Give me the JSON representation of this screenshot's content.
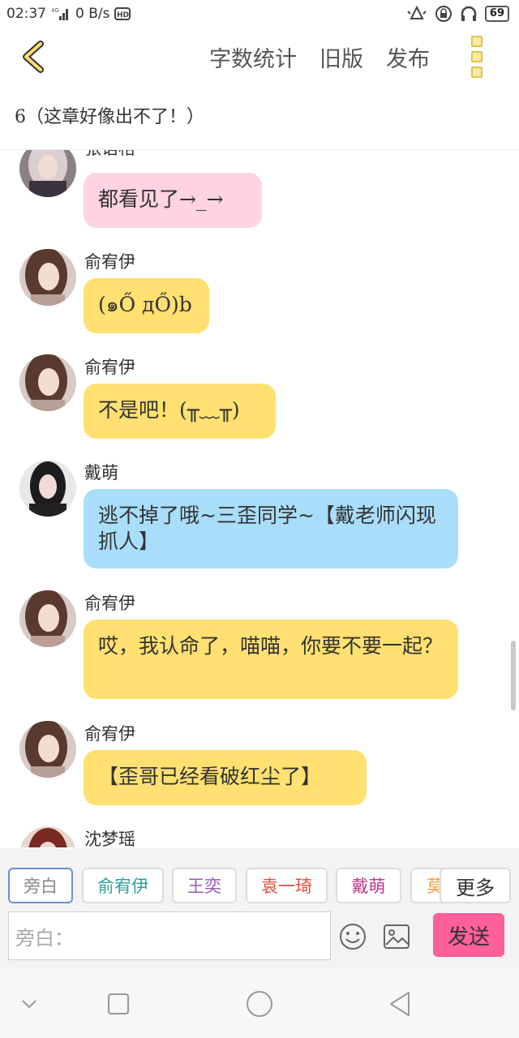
{
  "status_bar": {
    "time": "02:37",
    "network_speed": "0 B/s",
    "battery": "69"
  },
  "header": {
    "actions": [
      "字数统计",
      "旧版",
      "发布"
    ]
  },
  "chapter": {
    "title": "6（这章好像出不了！）"
  },
  "messages": [
    {
      "sender": "张语格",
      "text": "都看见了→_→",
      "bubble_color": "#ffd3df"
    },
    {
      "sender": "俞宥伊",
      "text": "(๑Ő дŐ)b",
      "bubble_color": "#ffe070"
    },
    {
      "sender": "俞宥伊",
      "text": "不是吧！(╥﹏╥)",
      "bubble_color": "#ffe070"
    },
    {
      "sender": "戴萌",
      "text": "逃不掉了哦~三歪同学~【戴老师闪现抓人】",
      "bubble_color": "#a9defb"
    },
    {
      "sender": "俞宥伊",
      "text": "哎，我认命了，喵喵，你要不要一起？",
      "bubble_color": "#ffe070"
    },
    {
      "sender": "俞宥伊",
      "text": "【歪哥已经看破红尘了】",
      "bubble_color": "#ffe070"
    },
    {
      "sender": "沈梦瑶",
      "text": "",
      "bubble_color": "#ffd3df"
    }
  ],
  "roles": [
    {
      "name": "旁白",
      "color": "#888888"
    },
    {
      "name": "俞宥伊",
      "color": "#2aa198"
    },
    {
      "name": "王奕",
      "color": "#9b59b6"
    },
    {
      "name": "袁一琦",
      "color": "#e74c3c"
    },
    {
      "name": "戴萌",
      "color": "#c0398c"
    },
    {
      "name": "莫",
      "color": "#f0a040"
    }
  ],
  "more_label": "更多",
  "input": {
    "placeholder": "旁白："
  },
  "send_label": "发送"
}
